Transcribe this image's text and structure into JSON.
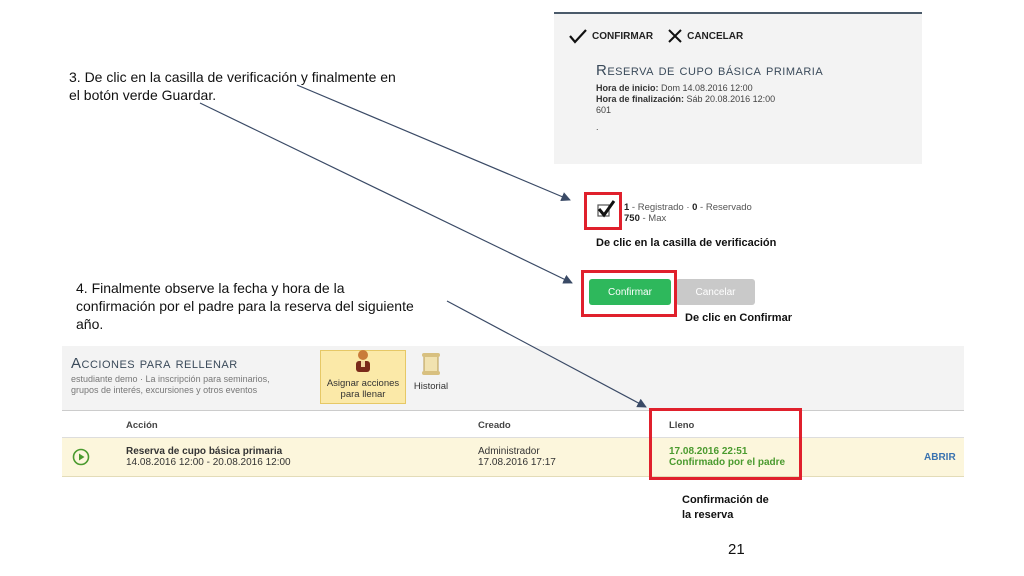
{
  "steps": {
    "step3": [
      "3.  De clic en la casilla de verificación y finalmente en",
      "el botón verde Guardar."
    ],
    "step4": [
      "4. Finalmente observe la fecha y hora de la",
      "confirmación por el padre para la reserva del siguiente",
      "año."
    ]
  },
  "dialog": {
    "confirm_label": "CONFIRMAR",
    "cancel_label": "CANCELAR",
    "title": "Reserva de cupo básica primaria",
    "start_label": "Hora de inicio:",
    "start_value": "Dom 14.08.2016 12:00",
    "end_label": "Hora de finalización:",
    "end_value": "Sáb 20.08.2016 12:00",
    "code": "601",
    "dot": "."
  },
  "checkbox": {
    "registered_count": "1",
    "registered_label": " - Registrado · ",
    "reserved_count": "0",
    "reserved_label": " - Reservado",
    "max_count": "750",
    "max_label": " - Max",
    "caption": "De clic en la casilla de verificación"
  },
  "buttons": {
    "confirm": "Confirmar",
    "cancel": "Cancelar",
    "caption": "De clic en Confirmar"
  },
  "actions": {
    "title": "Acciones para rellenar",
    "subtitle_1": "estudiante demo · La inscripción para seminarios,",
    "subtitle_2": "grupos de interés, excursiones y otros eventos",
    "assign_label_1": "Asignar acciones",
    "assign_label_2": "para llenar",
    "history_label": "Historial"
  },
  "table": {
    "headers": {
      "action": "Acción",
      "created": "Creado",
      "filled": "Lleno"
    },
    "row": {
      "action_title": "Reserva de cupo básica primaria",
      "action_dates": "14.08.2016 12:00 - 20.08.2016 12:00",
      "created_by": "Administrador",
      "created_at": "17.08.2016 17:17",
      "filled_at": "17.08.2016 22:51",
      "filled_status": "Confirmado por el padre",
      "open_label": "ABRIR"
    }
  },
  "confirmation_caption": [
    "Confirmación de",
    "la reserva"
  ],
  "page_number": "21",
  "colors": {
    "highlight": "#e0202c",
    "confirm_green": "#2eb85c",
    "cancel_gray": "#c9c9c9",
    "row_yellow": "#fcf6dc",
    "tile_yellow": "#fbe9a8",
    "link_blue": "#3a73b0",
    "status_green": "#4a9a2e"
  },
  "icons": [
    "check-icon",
    "close-icon",
    "checkbox-checked-icon",
    "play-circle-icon",
    "person-assign-icon",
    "scroll-history-icon"
  ]
}
